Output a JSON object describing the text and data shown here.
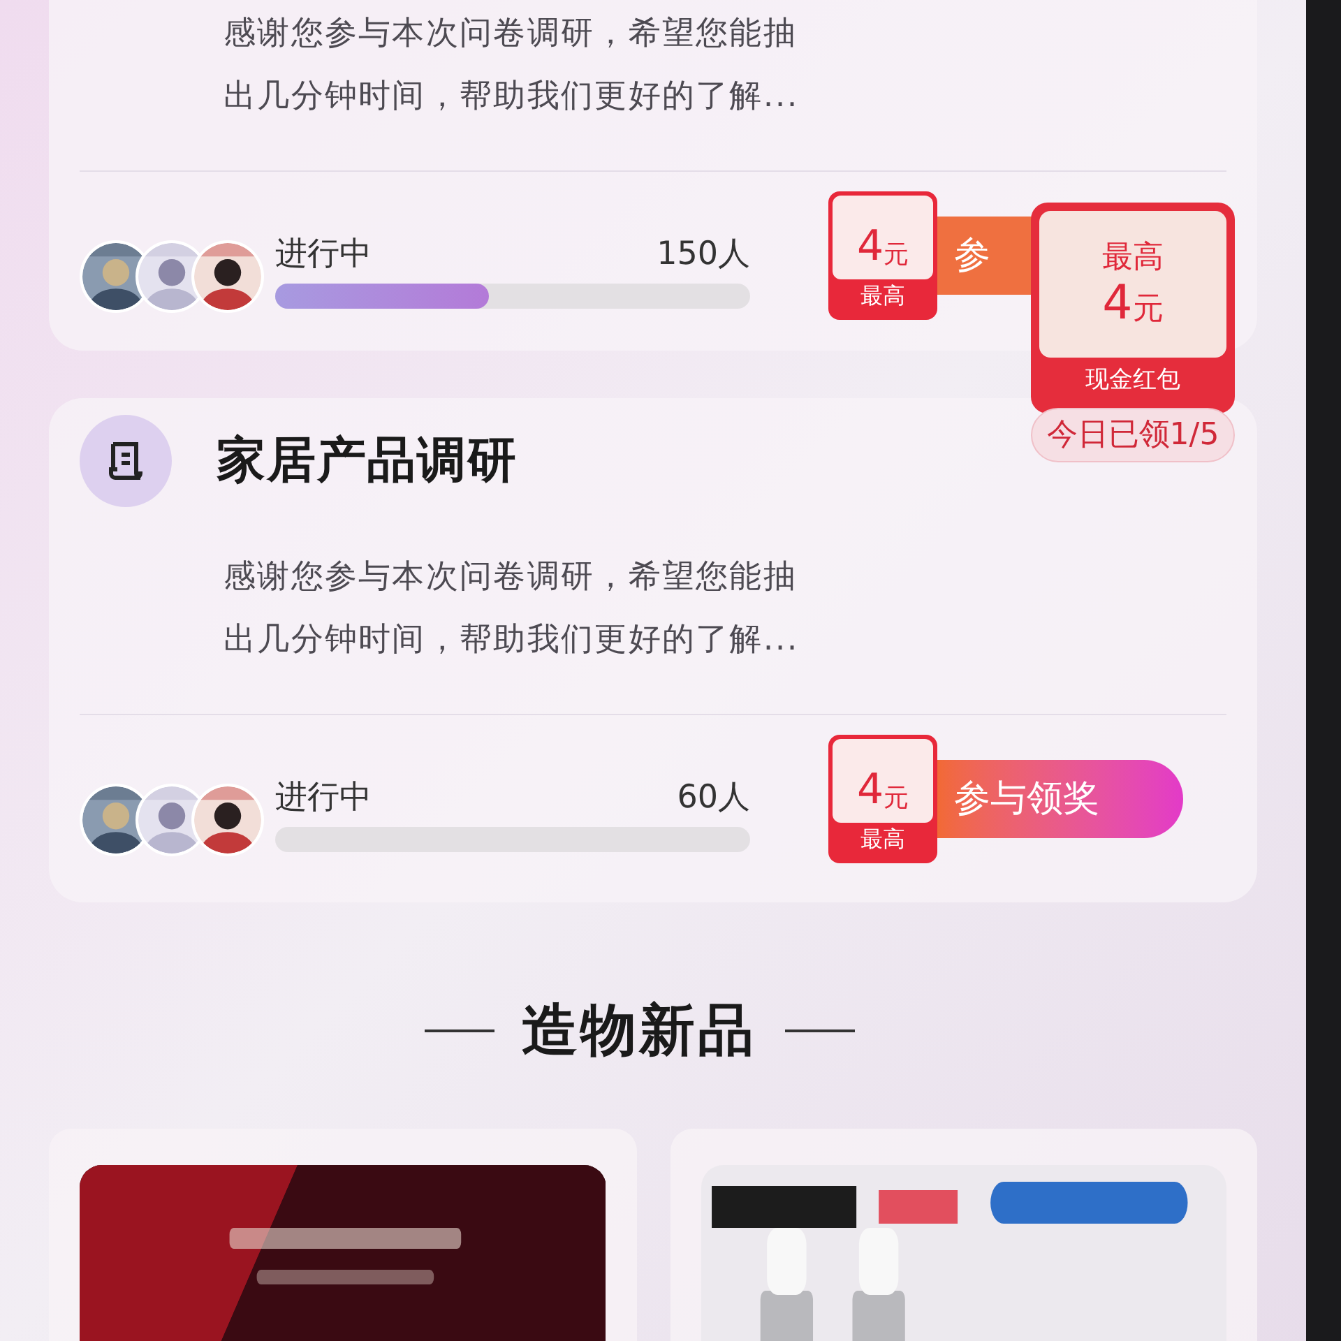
{
  "surveys": [
    {
      "description_lines": [
        "感谢您参与本次问卷调研，希望您能抽",
        "出几分钟时间，帮助我们更好的了解..."
      ],
      "status": "进行中",
      "count": "150人",
      "level": 0.45,
      "reward": {
        "amount": "4",
        "unit": "元",
        "caption": "最高"
      },
      "action": "参"
    },
    {
      "title": "家居产品调研",
      "description_lines": [
        "感谢您参与本次问卷调研，希望您能抽",
        "出几分钟时间，帮助我们更好的了解..."
      ],
      "status": "进行中",
      "count": "60人",
      "level": 0,
      "reward": {
        "amount": "4",
        "unit": "元",
        "caption": "最高"
      },
      "action": "参与领奖"
    }
  ],
  "red_packet_popup": {
    "heading": "最高",
    "amount": "4",
    "unit": "元",
    "caption": "现金红包",
    "claimed": "今日已领1/5"
  },
  "section_title": "造物新品"
}
